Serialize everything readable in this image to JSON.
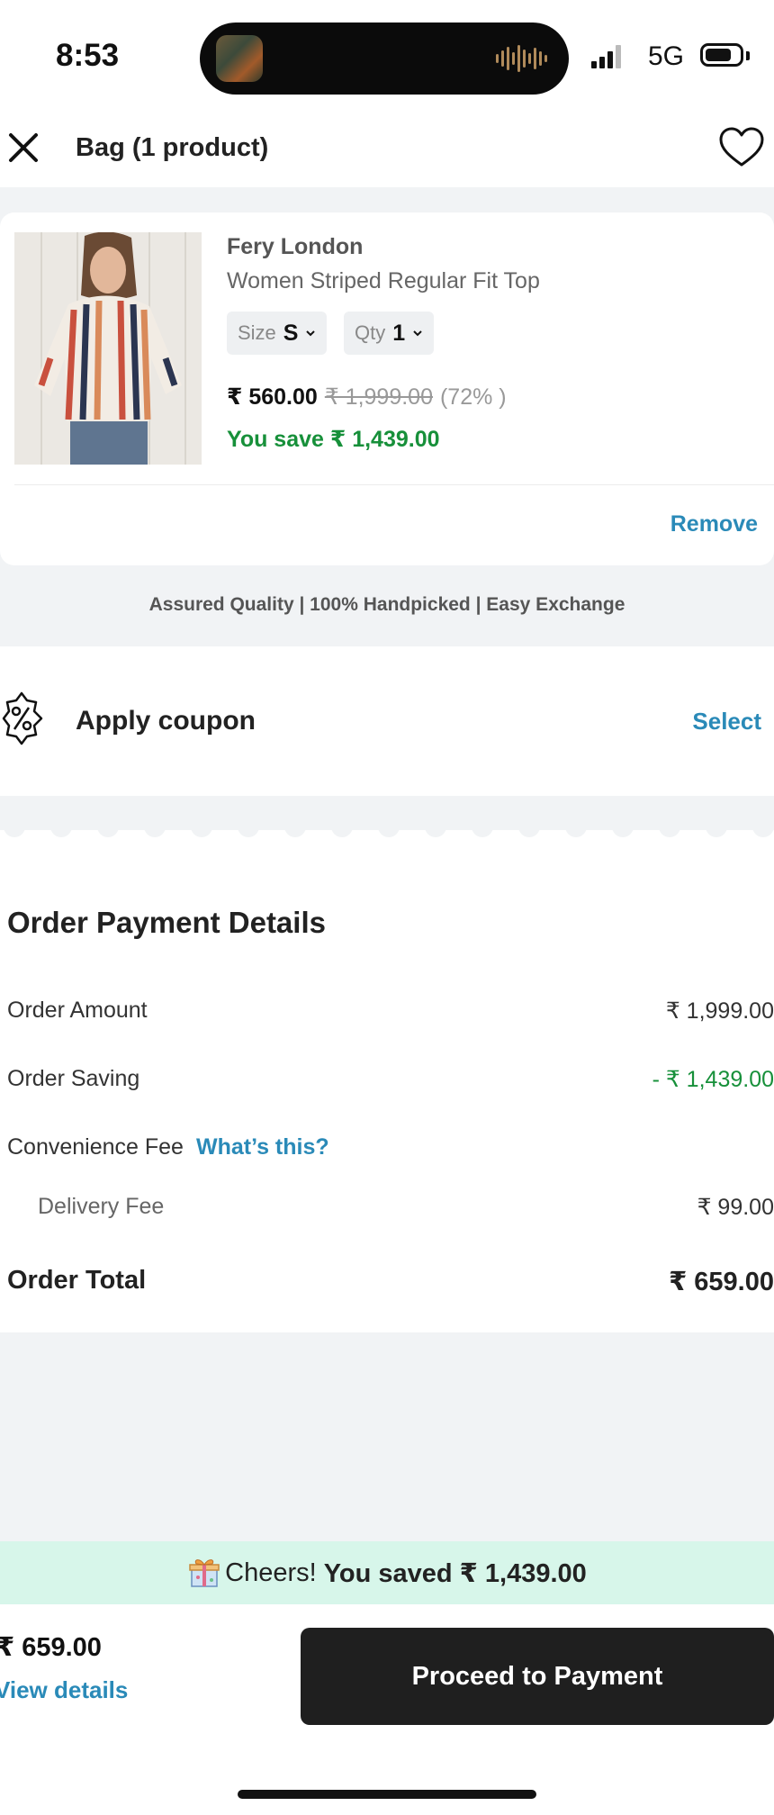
{
  "status": {
    "time": "8:53",
    "network": "5G"
  },
  "header": {
    "title": "Bag (1 product)"
  },
  "product": {
    "brand": "Fery London",
    "name": "Women Striped Regular Fit Top",
    "size_label": "Size",
    "size_value": "S",
    "qty_label": "Qty",
    "qty_value": "1",
    "price": "₹ 560.00",
    "mrp": "₹ 1,999.00",
    "discount": "(72% )",
    "you_save": "You save ₹ 1,439.00",
    "remove_label": "Remove"
  },
  "assurance": "Assured Quality | 100% Handpicked | Easy Exchange",
  "coupon": {
    "label": "Apply coupon",
    "action": "Select"
  },
  "payment": {
    "title": "Order Payment Details",
    "order_amount_label": "Order Amount",
    "order_amount_value": "₹ 1,999.00",
    "order_saving_label": "Order Saving",
    "order_saving_value": "- ₹ 1,439.00",
    "convenience_label": "Convenience Fee",
    "convenience_link": "What’s this?",
    "delivery_label": "Delivery Fee",
    "delivery_value": "₹ 99.00",
    "total_label": "Order Total",
    "total_value": "₹ 659.00"
  },
  "savings_banner": {
    "prefix": "Cheers!",
    "text": "You saved ₹ 1,439.00"
  },
  "bottom_bar": {
    "total": "₹ 659.00",
    "view_details": "View details",
    "proceed_label": "Proceed to Payment"
  },
  "colors": {
    "link": "#2a8ab8",
    "saving_green": "#17903a",
    "banner_mint": "#d7f6ea",
    "button_dark": "#1f1f1f"
  },
  "icons": [
    "close-icon",
    "heart-icon",
    "chevron-down-icon",
    "coupon-percent-icon",
    "gift-icon"
  ]
}
